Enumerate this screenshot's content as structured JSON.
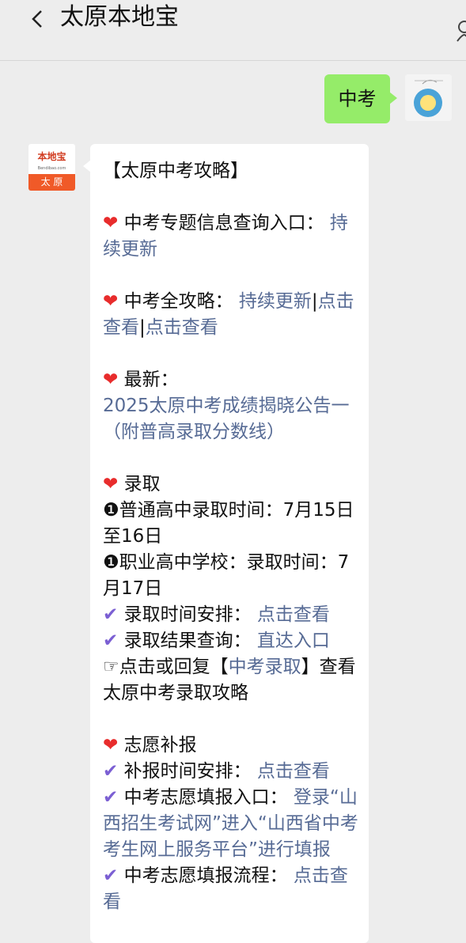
{
  "header": {
    "title": "太原本地宝",
    "back_icon": "chevron-left-icon",
    "profile_icon": "person-icon"
  },
  "sent_message": {
    "text": "中考"
  },
  "bot_avatar": {
    "logo_text": "本地宝",
    "logo_sub": "Bendibao.com",
    "logo_band": "太 原",
    "brand_color": "#f05a28"
  },
  "reply": {
    "title": "【太原中考攻略】",
    "sec1": {
      "heart": "❤",
      "label": "中考专题信息查询入口：",
      "link": "持续更新"
    },
    "sec2": {
      "heart": "❤",
      "label": "中考全攻略：",
      "link1": "持续更新",
      "sep1": "|",
      "link2": "点击查看",
      "sep2": "|",
      "link3": "点击查看"
    },
    "sec3": {
      "heart": "❤",
      "label": "最新：",
      "link": "2025太原中考成绩揭晓公告一（附普高录取分数线）"
    },
    "sec4": {
      "heart": "❤",
      "label": "录取",
      "line1": "❶普通高中录取时间：7月15日至16日",
      "line2": "❶职业高中学校：录取时间：7月17日",
      "item1_label": "录取时间安排：",
      "item1_link": "点击查看",
      "item2_label": "录取结果查询：",
      "item2_link": "直达入口",
      "hint_pre": "☞点击或回复【",
      "hint_link": "中考录取",
      "hint_post": "】查看太原中考录取攻略"
    },
    "sec5": {
      "heart": "❤",
      "label": "志愿补报",
      "item1_label": "补报时间安排：",
      "item1_link": "点击查看",
      "item2_label": "中考志愿填报入口：",
      "item2_link": "登录“山西招生考试网”进入“山西省中考考生网上服务平台”进行填报",
      "item3_label": "中考志愿填报流程：",
      "item3_link": "点击查看"
    },
    "check": "✔"
  },
  "colors": {
    "bubble_green": "#95ec69",
    "link_blue": "#576b95",
    "heart_red": "#e82c2c",
    "check_purple": "#7b5fd3"
  }
}
